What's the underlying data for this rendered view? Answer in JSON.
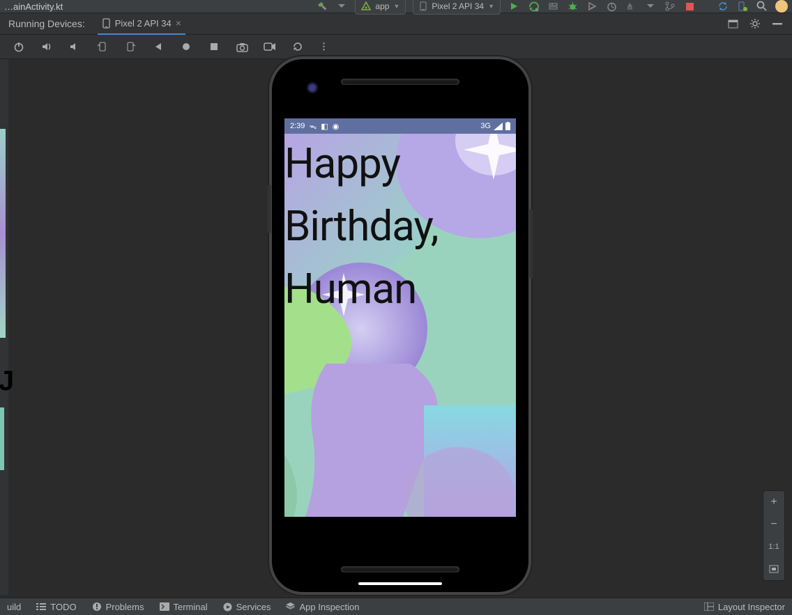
{
  "top": {
    "file": "…ainActivity.kt",
    "config": "app",
    "device_target": "Pixel 2 API 34"
  },
  "tabs": {
    "running_label": "Running Devices:",
    "device": "Pixel 2 API 34"
  },
  "emulator": {
    "statusbar": {
      "time": "2:39",
      "net": "3G"
    },
    "greeting": "Happy Birthday, Human"
  },
  "zoom": {
    "plus": "+",
    "minus": "−",
    "one": "1:1"
  },
  "bottom": {
    "build": "uild",
    "todo": "TODO",
    "problems": "Problems",
    "terminal": "Terminal",
    "services": "Services",
    "appinsp": "App Inspection",
    "layout": "Layout Inspector"
  }
}
